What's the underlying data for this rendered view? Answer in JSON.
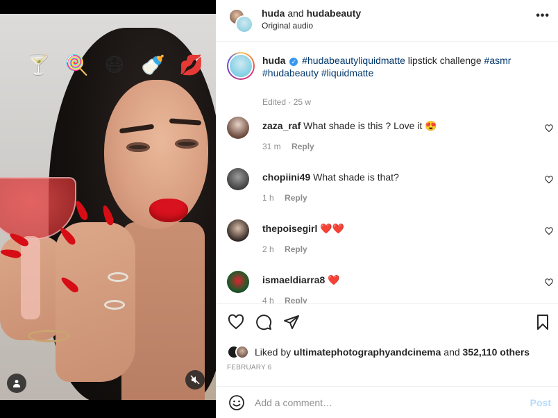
{
  "media": {
    "sticker_emojis": [
      "🍸",
      "🍭",
      "😷",
      "🍼",
      "💋"
    ],
    "user_tag_icon": "person-icon",
    "mute_icon": "speaker-muted-icon"
  },
  "header": {
    "author": "huda",
    "joiner": "and",
    "collaborator": "hudabeauty",
    "audio": "Original audio",
    "more_icon": "•••"
  },
  "caption": {
    "username": "huda",
    "verified_mark": "✓",
    "hashtag_1": "#hudabeautyliquidmatte",
    "text": " lipstick challenge ",
    "hashtag_2": "#asmr",
    "hashtag_3": "#hudabeauty",
    "hashtag_4": "#liquidmatte",
    "meta": "Edited · 25 w"
  },
  "comments": [
    {
      "username": "zaza_raf",
      "text": "What shade is this ? Love it 😍",
      "time": "31 m",
      "reply": "Reply"
    },
    {
      "username": "chopiini49",
      "text": "What shade is that?",
      "time": "1 h",
      "reply": "Reply"
    },
    {
      "username": "thepoisegirl",
      "text": "❤️❤️",
      "time": "2 h",
      "reply": "Reply"
    },
    {
      "username": "ismaeldiarra8",
      "text": "❤️",
      "time": "4 h",
      "reply": "Reply"
    }
  ],
  "likes": {
    "prefix": "Liked by",
    "user": "ultimatephotographyandcinema",
    "joiner": "and",
    "count": "352,110 others"
  },
  "date": "February 6",
  "add_comment": {
    "placeholder": "Add a comment…",
    "post_label": "Post"
  },
  "colors": {
    "link": "#00376b",
    "muted": "#8e8e8e",
    "post_disabled": "#b3dbff",
    "verified": "#3897f0"
  }
}
